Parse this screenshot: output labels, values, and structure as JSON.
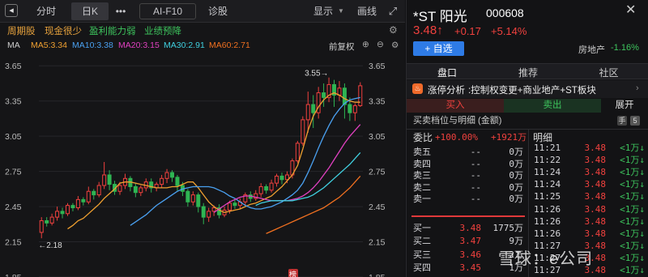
{
  "toolbar": {
    "back_icon": "back-arrow-icon",
    "tabs": [
      "分时",
      "日K",
      "•••",
      "AI-F10",
      "诊股"
    ],
    "selected_tab": "日K",
    "display_label": "显示",
    "draw_label": "画线"
  },
  "tags": [
    {
      "label": "周期股",
      "color": "#e8a33d"
    },
    {
      "label": "现金很少",
      "color": "#e8a33d"
    },
    {
      "label": "盈利能力弱",
      "color": "#3dc45d"
    },
    {
      "label": "业绩预降",
      "color": "#3dc45d"
    }
  ],
  "ma_legend": {
    "label": "MA",
    "items": [
      {
        "text": "MA5:3.34",
        "color": "#f0a030"
      },
      {
        "text": "MA10:3.38",
        "color": "#4aa0f0"
      },
      {
        "text": "MA20:3.15",
        "color": "#e040c0"
      },
      {
        "text": "MA30:2.91",
        "color": "#40d0e0"
      },
      {
        "text": "MA60:2.71",
        "color": "#f07020"
      }
    ],
    "fq_label": "前复权"
  },
  "chart_data": {
    "type": "candlestick",
    "y_ticks": [
      "3.65",
      "3.35",
      "3.05",
      "2.75",
      "2.45",
      "2.15",
      "1.85"
    ],
    "ylim": [
      1.85,
      3.7
    ],
    "annotations": {
      "high": "3.55→",
      "low": "←2.18"
    },
    "marker_label": "榜",
    "candles": [
      [
        2.23,
        2.33,
        2.18,
        2.36
      ],
      [
        2.33,
        2.31,
        2.28,
        2.36
      ],
      [
        2.31,
        2.36,
        2.29,
        2.39
      ],
      [
        2.36,
        2.41,
        2.33,
        2.45
      ],
      [
        2.41,
        2.39,
        2.35,
        2.44
      ],
      [
        2.39,
        2.46,
        2.37,
        2.48
      ],
      [
        2.46,
        2.44,
        2.41,
        2.48
      ],
      [
        2.44,
        2.51,
        2.42,
        2.54
      ],
      [
        2.51,
        2.49,
        2.46,
        2.53
      ],
      [
        2.49,
        2.58,
        2.47,
        2.62
      ],
      [
        2.58,
        2.55,
        2.51,
        2.6
      ],
      [
        2.55,
        2.63,
        2.53,
        2.66
      ],
      [
        2.63,
        2.72,
        2.6,
        2.83
      ],
      [
        2.72,
        2.64,
        2.59,
        2.76
      ],
      [
        2.64,
        2.58,
        2.55,
        2.67
      ],
      [
        2.58,
        2.63,
        2.55,
        2.66
      ],
      [
        2.63,
        2.69,
        2.6,
        2.73
      ],
      [
        2.69,
        2.62,
        2.58,
        2.71
      ],
      [
        2.62,
        2.57,
        2.53,
        2.65
      ],
      [
        2.57,
        2.61,
        2.54,
        2.63
      ],
      [
        2.61,
        2.66,
        2.58,
        2.69
      ],
      [
        2.66,
        2.61,
        2.57,
        2.69
      ],
      [
        2.61,
        2.64,
        2.58,
        2.66
      ],
      [
        2.64,
        2.69,
        2.61,
        2.72
      ],
      [
        2.69,
        2.74,
        2.65,
        2.77
      ],
      [
        2.74,
        2.7,
        2.66,
        2.76
      ],
      [
        2.7,
        2.63,
        2.58,
        2.72
      ],
      [
        2.63,
        2.58,
        2.54,
        2.66
      ],
      [
        2.58,
        2.49,
        2.45,
        2.6
      ],
      [
        2.49,
        2.55,
        2.46,
        2.58
      ],
      [
        2.55,
        2.45,
        2.4,
        2.57
      ],
      [
        2.45,
        2.36,
        2.3,
        2.48
      ],
      [
        2.36,
        2.41,
        2.32,
        2.44
      ],
      [
        2.41,
        2.44,
        2.37,
        2.46
      ],
      [
        2.44,
        2.38,
        2.35,
        2.47
      ],
      [
        2.38,
        2.42,
        2.36,
        2.45
      ],
      [
        2.42,
        2.48,
        2.39,
        2.5
      ],
      [
        2.48,
        2.46,
        2.43,
        2.51
      ],
      [
        2.46,
        2.49,
        2.43,
        2.52
      ],
      [
        2.49,
        2.55,
        2.46,
        2.57
      ],
      [
        2.55,
        2.52,
        2.49,
        2.58
      ],
      [
        2.52,
        2.56,
        2.5,
        2.59
      ],
      [
        2.56,
        2.62,
        2.53,
        2.65
      ],
      [
        2.62,
        2.59,
        2.56,
        2.64
      ],
      [
        2.59,
        2.65,
        2.57,
        2.68
      ],
      [
        2.65,
        2.71,
        2.62,
        2.73
      ],
      [
        2.71,
        2.68,
        2.64,
        2.74
      ],
      [
        2.68,
        2.72,
        2.65,
        2.75
      ],
      [
        2.72,
        2.84,
        2.69,
        2.86
      ],
      [
        2.84,
        2.99,
        2.82,
        3.01
      ],
      [
        2.99,
        3.19,
        2.97,
        3.22
      ],
      [
        3.19,
        3.32,
        3.08,
        3.43
      ],
      [
        3.32,
        3.25,
        3.12,
        3.4
      ],
      [
        3.25,
        3.42,
        3.2,
        3.47
      ],
      [
        3.42,
        3.38,
        3.3,
        3.5
      ],
      [
        3.38,
        3.49,
        3.34,
        3.55
      ],
      [
        3.49,
        3.4,
        3.3,
        3.53
      ],
      [
        3.4,
        3.46,
        3.35,
        3.52
      ],
      [
        3.46,
        3.32,
        3.2,
        3.5
      ],
      [
        3.32,
        3.25,
        3.18,
        3.38
      ],
      [
        3.25,
        3.31,
        3.18,
        3.33
      ],
      [
        3.31,
        3.48,
        3.3,
        3.51
      ]
    ],
    "ma": [
      {
        "name": "MA5",
        "color": "#f0a030",
        "values": [
          2.26,
          2.29,
          2.33,
          2.35,
          2.39,
          2.43,
          2.47,
          2.52,
          2.56,
          2.6,
          2.65,
          2.66,
          2.66,
          2.65,
          2.64,
          2.63,
          2.62,
          2.61,
          2.61,
          2.61,
          2.62,
          2.62,
          2.64,
          2.66,
          2.66,
          2.61,
          2.55,
          2.49,
          2.45,
          2.42,
          2.4,
          2.41,
          2.42,
          2.43,
          2.45,
          2.47,
          2.48,
          2.5,
          2.52,
          2.54,
          2.58,
          2.62,
          2.67,
          2.72,
          2.8,
          2.94,
          3.1,
          3.22,
          3.3,
          3.36,
          3.4,
          3.42,
          3.4,
          3.37,
          3.35,
          3.34,
          3.34
        ]
      },
      {
        "name": "MA10",
        "color": "#4aa0f0",
        "values": [
          2.29,
          2.32,
          2.35,
          2.38,
          2.42,
          2.46,
          2.49,
          2.52,
          2.55,
          2.58,
          2.6,
          2.61,
          2.62,
          2.62,
          2.62,
          2.62,
          2.61,
          2.59,
          2.57,
          2.54,
          2.52,
          2.49,
          2.46,
          2.44,
          2.43,
          2.43,
          2.44,
          2.45,
          2.47,
          2.49,
          2.52,
          2.55,
          2.59,
          2.65,
          2.74,
          2.84,
          2.95,
          3.05,
          3.14,
          3.22,
          3.28,
          3.33,
          3.36,
          3.37,
          3.38
        ]
      },
      {
        "name": "MA20",
        "color": "#e040c0",
        "values": [
          2.4,
          2.43,
          2.46,
          2.49,
          2.51,
          2.53,
          2.54,
          2.54,
          2.53,
          2.52,
          2.51,
          2.5,
          2.5,
          2.5,
          2.5,
          2.51,
          2.52,
          2.54,
          2.57,
          2.61,
          2.66,
          2.72,
          2.78,
          2.85,
          2.92,
          2.99,
          3.05,
          3.1,
          3.15
        ]
      },
      {
        "name": "MA30",
        "color": "#40d0e0",
        "values": [
          2.46,
          2.48,
          2.49,
          2.5,
          2.5,
          2.5,
          2.5,
          2.5,
          2.51,
          2.52,
          2.53,
          2.55,
          2.58,
          2.61,
          2.65,
          2.69,
          2.73,
          2.77,
          2.81,
          2.86,
          2.91
        ]
      },
      {
        "name": "MA60",
        "color": "#f07020",
        "values": [
          2.22,
          2.24,
          2.26,
          2.28,
          2.3,
          2.32,
          2.34,
          2.36,
          2.38,
          2.4,
          2.42,
          2.44,
          2.47,
          2.5,
          2.53,
          2.57,
          2.61,
          2.66,
          2.71
        ]
      }
    ]
  },
  "quote": {
    "name": "*ST 阳光",
    "code": "000608",
    "price": "3.48↑",
    "change": "+0.17",
    "pct": "+5.14%",
    "add_label": "+ 自选",
    "sector_name": "房地产",
    "sector_pct": "-1.16%"
  },
  "sections": {
    "tabs": [
      "盘口",
      "推荐",
      "社区"
    ],
    "news_label": "涨停分析",
    "news_text": ":控制权变更+商业地产+ST板块",
    "buy_label": "买入",
    "sell_label": "卖出",
    "expand_label": "展开"
  },
  "orderbook": {
    "title": "买卖档位与明细 (金额)",
    "badge_hand": "手",
    "badge_num": "5",
    "ratio_label": "委比",
    "ratio_pct": "+100.00%",
    "ratio_amt": "+1921万",
    "detail_label": "明细",
    "asks": [
      {
        "label": "卖五",
        "price": "--",
        "amt": "0万"
      },
      {
        "label": "卖四",
        "price": "--",
        "amt": "0万"
      },
      {
        "label": "卖三",
        "price": "--",
        "amt": "0万"
      },
      {
        "label": "卖二",
        "price": "--",
        "amt": "0万"
      },
      {
        "label": "卖一",
        "price": "--",
        "amt": "0万"
      }
    ],
    "bids": [
      {
        "label": "买一",
        "price": "3.48",
        "amt": "1775万"
      },
      {
        "label": "买二",
        "price": "3.47",
        "amt": "9万"
      },
      {
        "label": "买三",
        "price": "3.46",
        "amt": "2万"
      },
      {
        "label": "买四",
        "price": "3.45",
        "amt": "1万"
      }
    ],
    "ticks": [
      {
        "time": "11:21",
        "price": "3.48",
        "vol": "<1万↓"
      },
      {
        "time": "11:22",
        "price": "3.48",
        "vol": "<1万↓"
      },
      {
        "time": "11:24",
        "price": "3.48",
        "vol": "<1万↓"
      },
      {
        "time": "11:24",
        "price": "3.48",
        "vol": "<1万↓"
      },
      {
        "time": "11:25",
        "price": "3.48",
        "vol": "<1万↓"
      },
      {
        "time": "11:26",
        "price": "3.48",
        "vol": "<1万↓"
      },
      {
        "time": "11:26",
        "price": "3.48",
        "vol": "<1万↓"
      },
      {
        "time": "11:26",
        "price": "3.48",
        "vol": "<1万↓"
      },
      {
        "time": "11:27",
        "price": "3.48",
        "vol": "<1万↓"
      },
      {
        "time": "11:27",
        "price": "3.48",
        "vol": "<1万↓"
      },
      {
        "time": "11:27",
        "price": "3.48",
        "vol": "<1万↓"
      }
    ]
  },
  "watermark": "雪球：e公司"
}
